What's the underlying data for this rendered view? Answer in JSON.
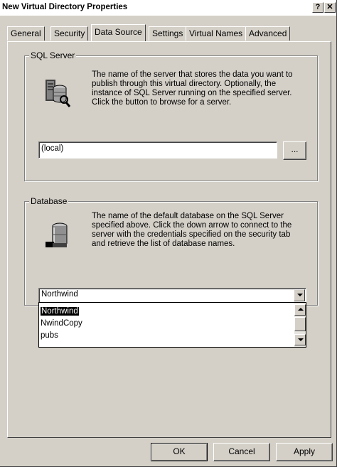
{
  "window": {
    "title": "New Virtual Directory Properties",
    "help_label": "?",
    "close_label": "✕"
  },
  "tabs": [
    {
      "label": "General",
      "active": false
    },
    {
      "label": "Security",
      "active": false
    },
    {
      "label": "Data Source",
      "active": true
    },
    {
      "label": "Settings",
      "active": false
    },
    {
      "label": "Virtual Names",
      "active": false
    },
    {
      "label": "Advanced",
      "active": false
    }
  ],
  "sql_server": {
    "group_label": "SQL Server",
    "description": "The name of the server that stores the data you want to publish through this virtual directory.  Optionally, the instance of SQL Server running on the specified server.  Click the button to browse for a server.",
    "value": "(local)",
    "browse_label": "..."
  },
  "database": {
    "group_label": "Database",
    "description": "The name of the default database on the SQL Server specified above.  Click the down arrow to connect to the server with the credentials specified on the security tab and retrieve the list of database names.",
    "selected": "Northwind",
    "options": [
      "Northwind",
      "NwindCopy",
      "pubs"
    ]
  },
  "buttons": {
    "ok": "OK",
    "cancel": "Cancel",
    "apply": "Apply"
  }
}
